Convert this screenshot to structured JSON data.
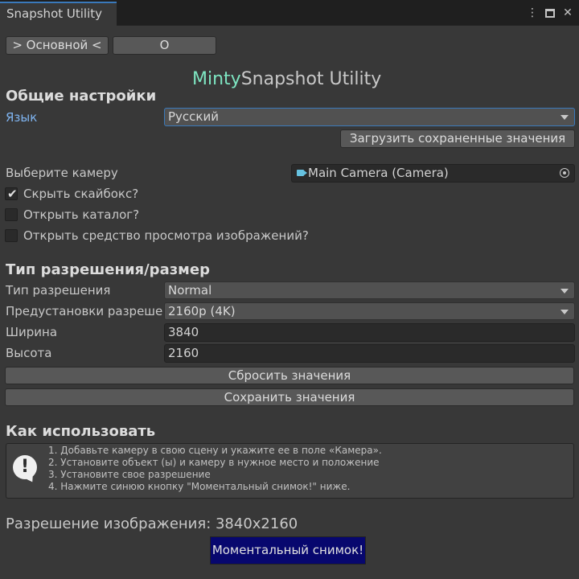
{
  "window": {
    "tab_title": "Snapshot Utility",
    "icons": [
      "more-vert-icon",
      "maximize-icon",
      "close-icon"
    ]
  },
  "top_buttons": {
    "main": "> Основной <",
    "about": "O"
  },
  "app_title": {
    "accent": "Minty",
    "rest": "Snapshot Utility"
  },
  "general": {
    "heading": "Общие настройки",
    "language_label": "Язык",
    "language_value": "Русский",
    "load_button": "Загрузить сохраненные значения",
    "camera_label": "Выберите камеру",
    "camera_value": "Main Camera (Camera)",
    "checkboxes": [
      {
        "label": "Скрыть скайбокс?",
        "checked": true
      },
      {
        "label": "Открыть каталог?",
        "checked": false
      },
      {
        "label": "Открыть средство просмотра изображений?",
        "checked": false
      }
    ]
  },
  "resolution": {
    "heading": "Тип разрешения/размер",
    "type_label": "Тип разрешения",
    "type_value": "Normal",
    "preset_label": "Предустановки разрешен",
    "preset_value": "2160p (4K)",
    "width_label": "Ширина",
    "width_value": "3840",
    "height_label": "Высота",
    "height_value": "2160",
    "reset_button": "Сбросить значения",
    "save_button": "Сохранить значения"
  },
  "howto": {
    "heading": "Как использовать",
    "steps": [
      "1. Добавьте камеру в свою сцену и укажите ее в поле «Камера».",
      "2. Установите объект (ы) и камеру в нужное место и положение",
      "3. Установите свое разрешение",
      "4. Нажмите синюю кнопку \"Моментальный снимок!\" ниже."
    ]
  },
  "image_resolution_text": "Разрешение изображения: 3840x2160",
  "snapshot_button": "Моментальный снимок!",
  "colors": {
    "accent": "#7ee6c2",
    "snapshot_bg": "#07076e",
    "focus": "#3a79bb",
    "label_blue": "#7fb4f0"
  }
}
